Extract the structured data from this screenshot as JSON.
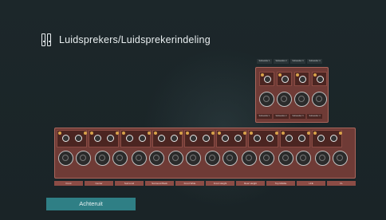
{
  "header": {
    "title": "Luidsprekers/Luidsprekerindeling",
    "icon": "speaker-icon"
  },
  "subwoofer": {
    "top_labels": [
      "Subwoofer 1",
      "Subwoofer 2",
      "Subwoofer 3",
      "Subwoofer 4"
    ],
    "bottom_labels": [
      "Subwoofer 1",
      "Subwoofer 2",
      "Subwoofer 3",
      "Subwoofer 4"
    ]
  },
  "main": {
    "channel_labels": [
      "Front",
      "Center",
      "Surround",
      "Surround Back",
      "Front Wide",
      "Front Height",
      "Rear Height",
      "Top Middle",
      "LFE",
      "FL"
    ]
  },
  "footer": {
    "back_label": "Achteruit"
  },
  "colors": {
    "background": "#1b2629",
    "panel": "#6f3b36",
    "button": "#2f7f85"
  }
}
